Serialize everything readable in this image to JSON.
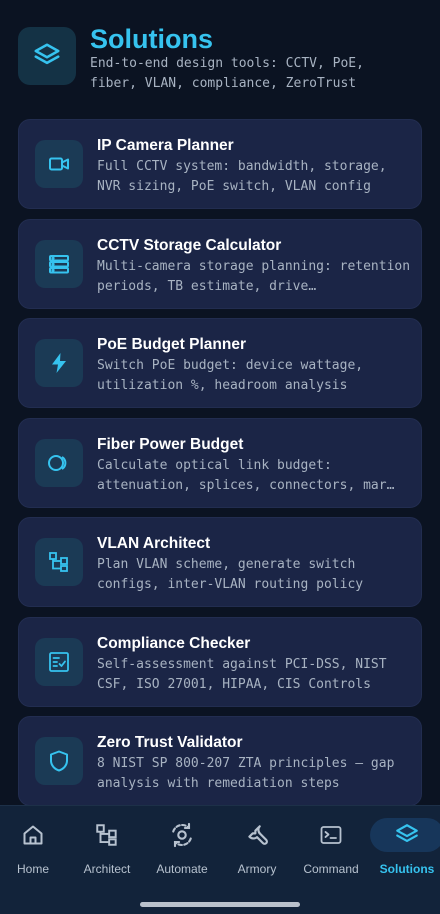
{
  "header": {
    "title": "Solutions",
    "subtitle": "End-to-end design tools: CCTV, PoE, fiber, VLAN, compliance, ZeroTrust",
    "icon": "layers-icon"
  },
  "cards": [
    {
      "title": "IP Camera Planner",
      "description": "Full CCTV system: bandwidth, storage, NVR sizing, PoE switch, VLAN config",
      "icon": "video-camera-icon"
    },
    {
      "title": "CCTV Storage Calculator",
      "description": "Multi-camera storage planning: retention periods, TB estimate, drive…",
      "icon": "storage-icon"
    },
    {
      "title": "PoE Budget Planner",
      "description": "Switch PoE budget: device wattage, utilization %, headroom analysis",
      "icon": "lightning-icon"
    },
    {
      "title": "Fiber Power Budget",
      "description": "Calculate optical link budget: attenuation, splices, connectors, mar…",
      "icon": "fiber-rings-icon"
    },
    {
      "title": "VLAN Architect",
      "description": "Plan VLAN scheme, generate switch configs, inter-VLAN routing policy",
      "icon": "network-tree-icon"
    },
    {
      "title": "Compliance Checker",
      "description": "Self-assessment against PCI-DSS, NIST CSF, ISO 27001, HIPAA, CIS Controls",
      "icon": "checklist-icon"
    },
    {
      "title": "Zero Trust Validator",
      "description": "8 NIST SP 800-207 ZTA principles — gap analysis with remediation steps",
      "icon": "shield-icon"
    }
  ],
  "nav": [
    {
      "label": "Home",
      "icon": "home-icon"
    },
    {
      "label": "Architect",
      "icon": "network-tree-icon"
    },
    {
      "label": "Automate",
      "icon": "automate-icon"
    },
    {
      "label": "Armory",
      "icon": "wrench-icon"
    },
    {
      "label": "Command",
      "icon": "terminal-icon"
    },
    {
      "label": "Solutions",
      "icon": "layers-icon",
      "active": true
    }
  ],
  "colors": {
    "accent": "#36c3ef",
    "background": "#0b1322",
    "card": "#1b2546",
    "nav": "#12233a"
  }
}
